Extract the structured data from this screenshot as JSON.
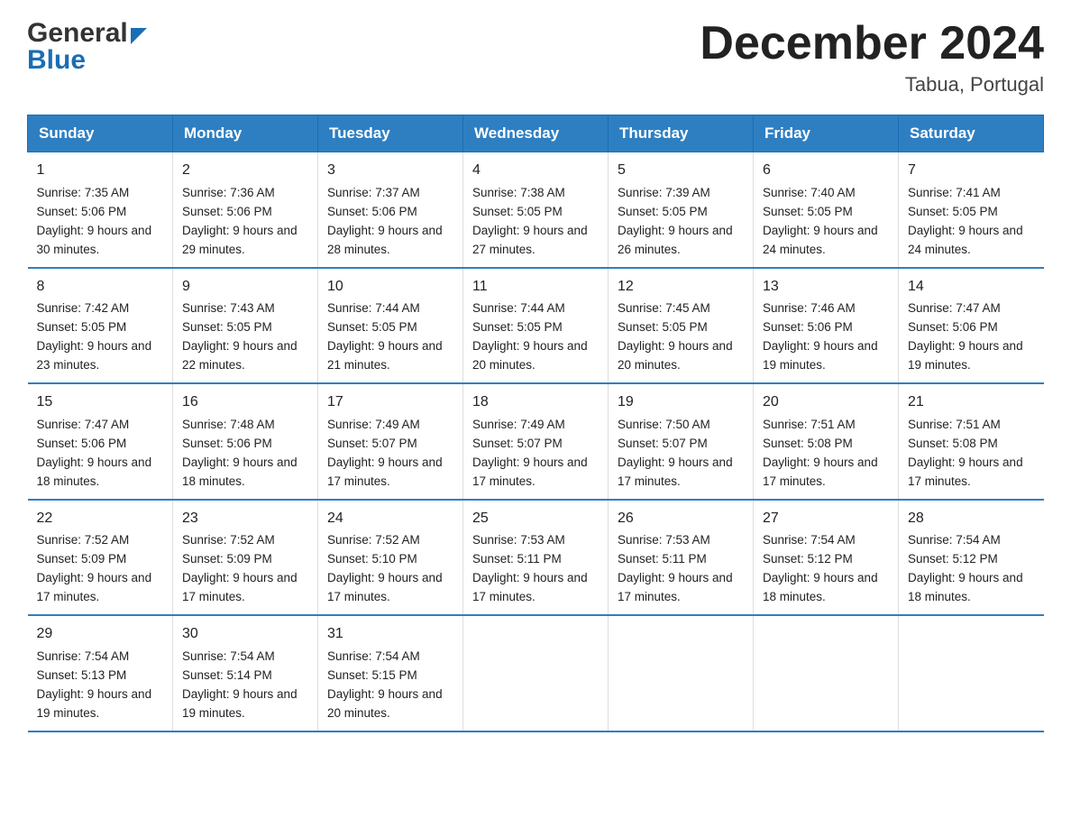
{
  "header": {
    "logo_general": "General",
    "logo_blue": "Blue",
    "month_title": "December 2024",
    "location": "Tabua, Portugal"
  },
  "days_of_week": [
    "Sunday",
    "Monday",
    "Tuesday",
    "Wednesday",
    "Thursday",
    "Friday",
    "Saturday"
  ],
  "weeks": [
    [
      {
        "day": "1",
        "sunrise": "7:35 AM",
        "sunset": "5:06 PM",
        "daylight": "9 hours and 30 minutes."
      },
      {
        "day": "2",
        "sunrise": "7:36 AM",
        "sunset": "5:06 PM",
        "daylight": "9 hours and 29 minutes."
      },
      {
        "day": "3",
        "sunrise": "7:37 AM",
        "sunset": "5:06 PM",
        "daylight": "9 hours and 28 minutes."
      },
      {
        "day": "4",
        "sunrise": "7:38 AM",
        "sunset": "5:05 PM",
        "daylight": "9 hours and 27 minutes."
      },
      {
        "day": "5",
        "sunrise": "7:39 AM",
        "sunset": "5:05 PM",
        "daylight": "9 hours and 26 minutes."
      },
      {
        "day": "6",
        "sunrise": "7:40 AM",
        "sunset": "5:05 PM",
        "daylight": "9 hours and 24 minutes."
      },
      {
        "day": "7",
        "sunrise": "7:41 AM",
        "sunset": "5:05 PM",
        "daylight": "9 hours and 24 minutes."
      }
    ],
    [
      {
        "day": "8",
        "sunrise": "7:42 AM",
        "sunset": "5:05 PM",
        "daylight": "9 hours and 23 minutes."
      },
      {
        "day": "9",
        "sunrise": "7:43 AM",
        "sunset": "5:05 PM",
        "daylight": "9 hours and 22 minutes."
      },
      {
        "day": "10",
        "sunrise": "7:44 AM",
        "sunset": "5:05 PM",
        "daylight": "9 hours and 21 minutes."
      },
      {
        "day": "11",
        "sunrise": "7:44 AM",
        "sunset": "5:05 PM",
        "daylight": "9 hours and 20 minutes."
      },
      {
        "day": "12",
        "sunrise": "7:45 AM",
        "sunset": "5:05 PM",
        "daylight": "9 hours and 20 minutes."
      },
      {
        "day": "13",
        "sunrise": "7:46 AM",
        "sunset": "5:06 PM",
        "daylight": "9 hours and 19 minutes."
      },
      {
        "day": "14",
        "sunrise": "7:47 AM",
        "sunset": "5:06 PM",
        "daylight": "9 hours and 19 minutes."
      }
    ],
    [
      {
        "day": "15",
        "sunrise": "7:47 AM",
        "sunset": "5:06 PM",
        "daylight": "9 hours and 18 minutes."
      },
      {
        "day": "16",
        "sunrise": "7:48 AM",
        "sunset": "5:06 PM",
        "daylight": "9 hours and 18 minutes."
      },
      {
        "day": "17",
        "sunrise": "7:49 AM",
        "sunset": "5:07 PM",
        "daylight": "9 hours and 17 minutes."
      },
      {
        "day": "18",
        "sunrise": "7:49 AM",
        "sunset": "5:07 PM",
        "daylight": "9 hours and 17 minutes."
      },
      {
        "day": "19",
        "sunrise": "7:50 AM",
        "sunset": "5:07 PM",
        "daylight": "9 hours and 17 minutes."
      },
      {
        "day": "20",
        "sunrise": "7:51 AM",
        "sunset": "5:08 PM",
        "daylight": "9 hours and 17 minutes."
      },
      {
        "day": "21",
        "sunrise": "7:51 AM",
        "sunset": "5:08 PM",
        "daylight": "9 hours and 17 minutes."
      }
    ],
    [
      {
        "day": "22",
        "sunrise": "7:52 AM",
        "sunset": "5:09 PM",
        "daylight": "9 hours and 17 minutes."
      },
      {
        "day": "23",
        "sunrise": "7:52 AM",
        "sunset": "5:09 PM",
        "daylight": "9 hours and 17 minutes."
      },
      {
        "day": "24",
        "sunrise": "7:52 AM",
        "sunset": "5:10 PM",
        "daylight": "9 hours and 17 minutes."
      },
      {
        "day": "25",
        "sunrise": "7:53 AM",
        "sunset": "5:11 PM",
        "daylight": "9 hours and 17 minutes."
      },
      {
        "day": "26",
        "sunrise": "7:53 AM",
        "sunset": "5:11 PM",
        "daylight": "9 hours and 17 minutes."
      },
      {
        "day": "27",
        "sunrise": "7:54 AM",
        "sunset": "5:12 PM",
        "daylight": "9 hours and 18 minutes."
      },
      {
        "day": "28",
        "sunrise": "7:54 AM",
        "sunset": "5:12 PM",
        "daylight": "9 hours and 18 minutes."
      }
    ],
    [
      {
        "day": "29",
        "sunrise": "7:54 AM",
        "sunset": "5:13 PM",
        "daylight": "9 hours and 19 minutes."
      },
      {
        "day": "30",
        "sunrise": "7:54 AM",
        "sunset": "5:14 PM",
        "daylight": "9 hours and 19 minutes."
      },
      {
        "day": "31",
        "sunrise": "7:54 AM",
        "sunset": "5:15 PM",
        "daylight": "9 hours and 20 minutes."
      },
      null,
      null,
      null,
      null
    ]
  ],
  "labels": {
    "sunrise_prefix": "Sunrise: ",
    "sunset_prefix": "Sunset: ",
    "daylight_prefix": "Daylight: "
  }
}
